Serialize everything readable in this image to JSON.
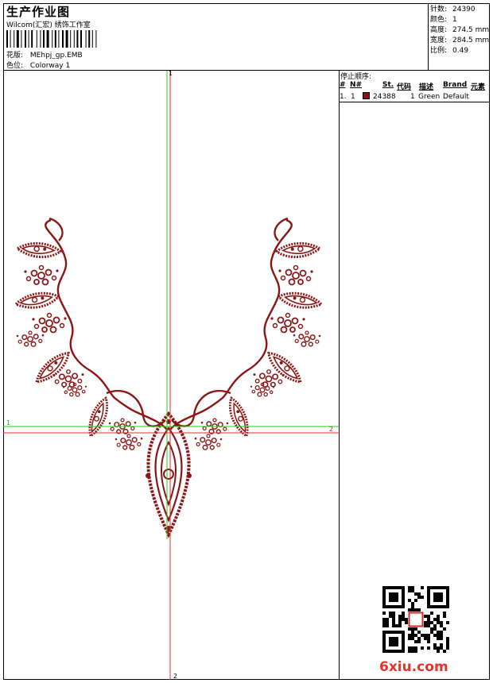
{
  "header": {
    "title": "生产作业图",
    "company": "Wilcom(汇宏) 绣饰工作室",
    "design_label": "花版:",
    "design_value": "MEhpj_gp.EMB",
    "colorway_label": "色位:",
    "colorway_value": "Colorway 1"
  },
  "stats": [
    {
      "key": "针数:",
      "value": "24390"
    },
    {
      "key": "颜色:",
      "value": "1"
    },
    {
      "key": "高度:",
      "value": "274.5 mm"
    },
    {
      "key": "宽度:",
      "value": "284.5 mm"
    },
    {
      "key": "比例:",
      "value": "0.49"
    }
  ],
  "sequence": {
    "title": "停止顺序:",
    "headers": {
      "hash": "#",
      "num": "N#",
      "st": "St.",
      "code": "代码",
      "desc": "描述",
      "brand": "Brand",
      "elem": "元素"
    },
    "rows": [
      {
        "index": "1.",
        "num": "1",
        "stitches": "24388",
        "code": "1",
        "desc": "Green",
        "brand": "Default",
        "color": "#8b1414"
      }
    ]
  },
  "axes": {
    "v_top": "1",
    "v_bottom": "2",
    "h_left": "1",
    "h_right": "2"
  },
  "design": {
    "thread_color": "#8b1414",
    "guide_green": "#22cc22",
    "guide_red": "#e03030"
  },
  "watermark": "6xiu.com"
}
